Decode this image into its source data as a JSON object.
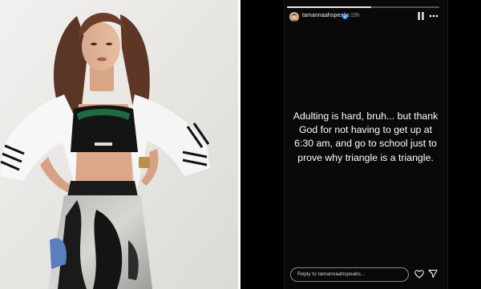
{
  "header": {
    "username": "tamannaahspeaks",
    "time_ago": "15h",
    "progress": 0.55
  },
  "icons": {
    "verified": "verified-badge-icon",
    "pause": "pause-icon",
    "more": "more-options-icon",
    "like": "heart-icon",
    "send": "send-icon"
  },
  "story": {
    "text": "Adulting is hard, bruh... but thank\nGod for not having to get up at\n6:30 am, and go to school just to\nprove why triangle is a triangle."
  },
  "reply": {
    "placeholder": "Reply to tamannaahspeaks..."
  },
  "colors": {
    "background": "#000000",
    "story_bg": "#090909",
    "text": "#ffffff",
    "muted": "#9a9a9a",
    "verified": "#3897f0"
  }
}
